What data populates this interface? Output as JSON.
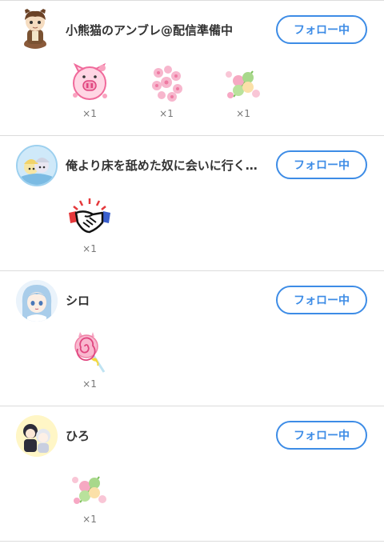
{
  "rows": [
    {
      "username": "小熊猫のアンブレ@配信準備中",
      "follow_label": "フォロー中",
      "gifts": [
        {
          "icon": "pink-pig-sticker-icon",
          "count": "×1"
        },
        {
          "icon": "sakura-flowers-icon",
          "count": "×1"
        },
        {
          "icon": "dango-flowers-icon",
          "count": "×1"
        }
      ]
    },
    {
      "username": "俺より床を舐めた奴に会いに行く…",
      "follow_label": "フォロー中",
      "gifts": [
        {
          "icon": "handshake-icon",
          "count": "×1"
        }
      ]
    },
    {
      "username": "シロ",
      "follow_label": "フォロー中",
      "gifts": [
        {
          "icon": "swirl-lollipop-icon",
          "count": "×1"
        }
      ]
    },
    {
      "username": "ひろ",
      "follow_label": "フォロー中",
      "gifts": [
        {
          "icon": "dango-flowers-icon",
          "count": "×1"
        }
      ]
    }
  ]
}
